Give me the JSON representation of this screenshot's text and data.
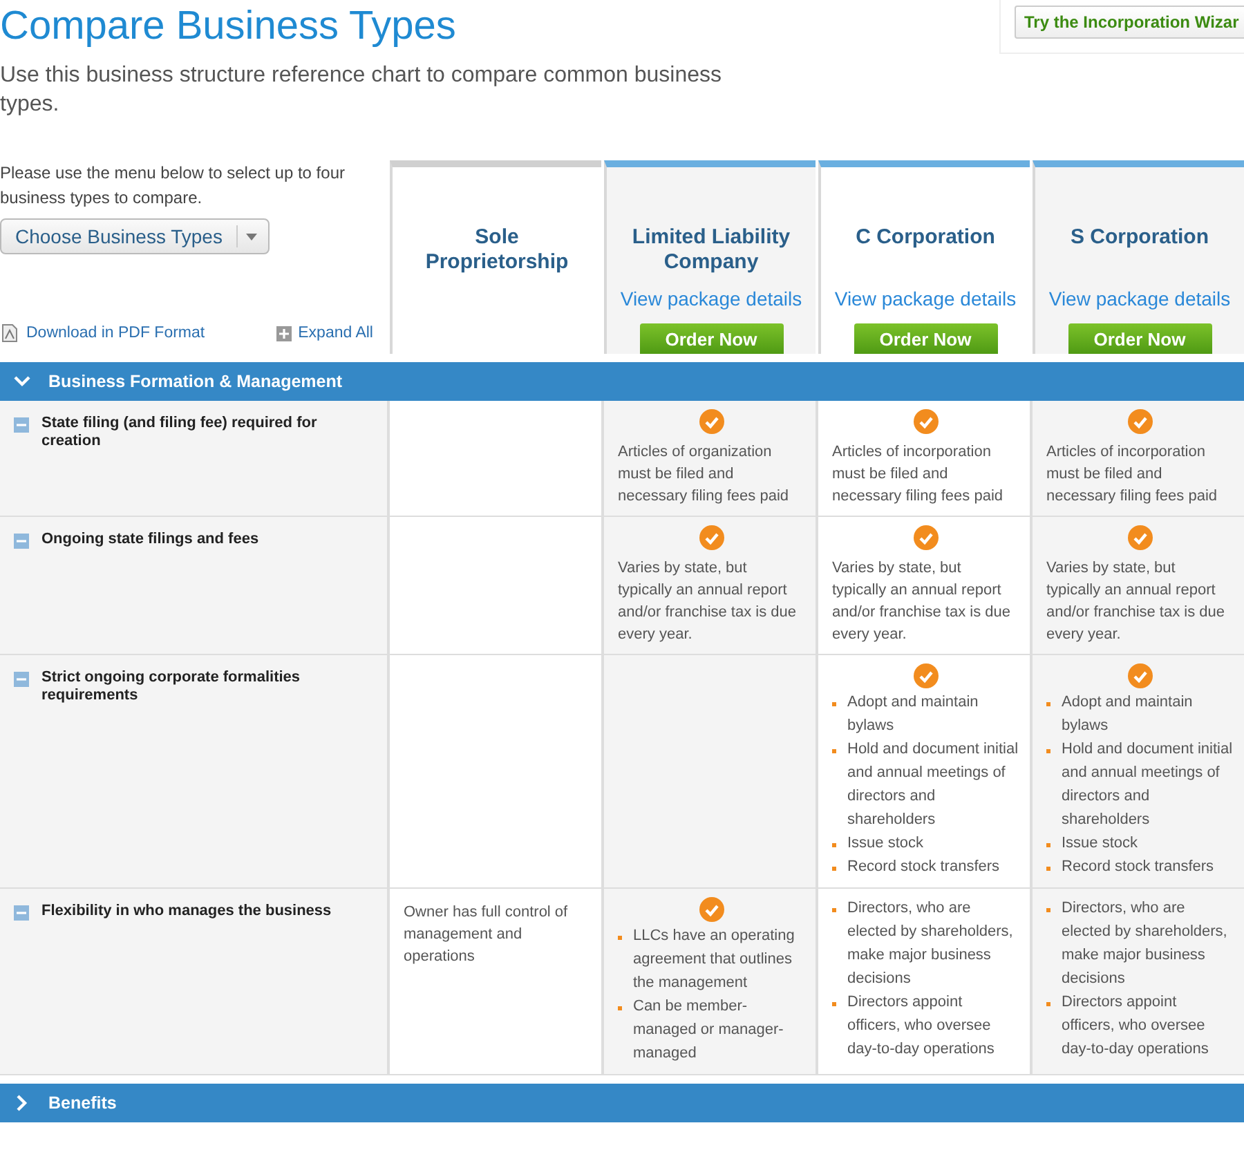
{
  "title": "Compare Business Types",
  "subtitle": "Use this business structure reference chart to compare common business types.",
  "wizard_button": "Try the Incorporation Wizar",
  "prompt": "Please use the menu below to select up to four business types to compare.",
  "dropdown": {
    "label": "Choose Business Types"
  },
  "pdf_link": "Download in PDF Format",
  "expand_all": "Expand All",
  "columns": [
    {
      "name": "Sole Proprietorship"
    },
    {
      "name": "Limited Liability Company",
      "link": "View package details",
      "button": "Order Now"
    },
    {
      "name": "C Corporation",
      "link": "View package details",
      "button": "Order Now"
    },
    {
      "name": "S Corporation",
      "link": "View package details",
      "button": "Order Now"
    }
  ],
  "sections": [
    {
      "title": "Business Formation & Management",
      "expanded": true,
      "rows": [
        {
          "label": "State filing (and filing fee) required for creation",
          "expanded": true,
          "cells": [
            {
              "kind": "empty",
              "checked": false
            },
            {
              "kind": "text",
              "checked": true,
              "text": "Articles of organization must be filed and necessary filing fees paid"
            },
            {
              "kind": "text",
              "checked": true,
              "text": "Articles of incorporation must be filed and necessary filing fees paid"
            },
            {
              "kind": "text",
              "checked": true,
              "text": "Articles of incorporation must be filed and necessary filing fees paid"
            }
          ]
        },
        {
          "label": "Ongoing state filings and fees",
          "expanded": true,
          "cells": [
            {
              "kind": "empty",
              "checked": false
            },
            {
              "kind": "text",
              "checked": true,
              "text": "Varies by state, but typically an annual report and/or franchise tax is due every year."
            },
            {
              "kind": "text",
              "checked": true,
              "text": "Varies by state, but typically an annual report and/or franchise tax is due every year."
            },
            {
              "kind": "text",
              "checked": true,
              "text": "Varies by state, but typically an annual report and/or franchise tax is due every year."
            }
          ]
        },
        {
          "label": "Strict ongoing corporate formalities requirements",
          "expanded": true,
          "cells": [
            {
              "kind": "empty",
              "checked": false
            },
            {
              "kind": "empty",
              "checked": false
            },
            {
              "kind": "bullets",
              "checked": true,
              "bullets": [
                "Adopt and maintain bylaws",
                "Hold and document initial and annual meetings of directors and shareholders",
                "Issue stock",
                "Record stock transfers"
              ]
            },
            {
              "kind": "bullets",
              "checked": true,
              "bullets": [
                "Adopt and maintain bylaws",
                "Hold and document initial and annual meetings of directors and shareholders",
                "Issue stock",
                "Record stock transfers"
              ]
            }
          ]
        },
        {
          "label": "Flexibility in who manages the business",
          "expanded": true,
          "cells": [
            {
              "kind": "text",
              "checked": false,
              "text": "Owner has full control of management and operations"
            },
            {
              "kind": "bullets",
              "checked": true,
              "bullets": [
                "LLCs have an operating agreement that outlines the management",
                "Can be member-managed or manager-managed"
              ]
            },
            {
              "kind": "bullets",
              "checked": false,
              "bullets": [
                "Directors, who are elected by shareholders, make major business decisions",
                "Directors appoint officers, who oversee day-to-day operations"
              ]
            },
            {
              "kind": "bullets",
              "checked": false,
              "bullets": [
                "Directors, who are elected by shareholders, make major business decisions",
                "Directors appoint officers, who oversee day-to-day operations"
              ]
            }
          ]
        }
      ]
    },
    {
      "title": "Benefits",
      "expanded": false
    }
  ]
}
